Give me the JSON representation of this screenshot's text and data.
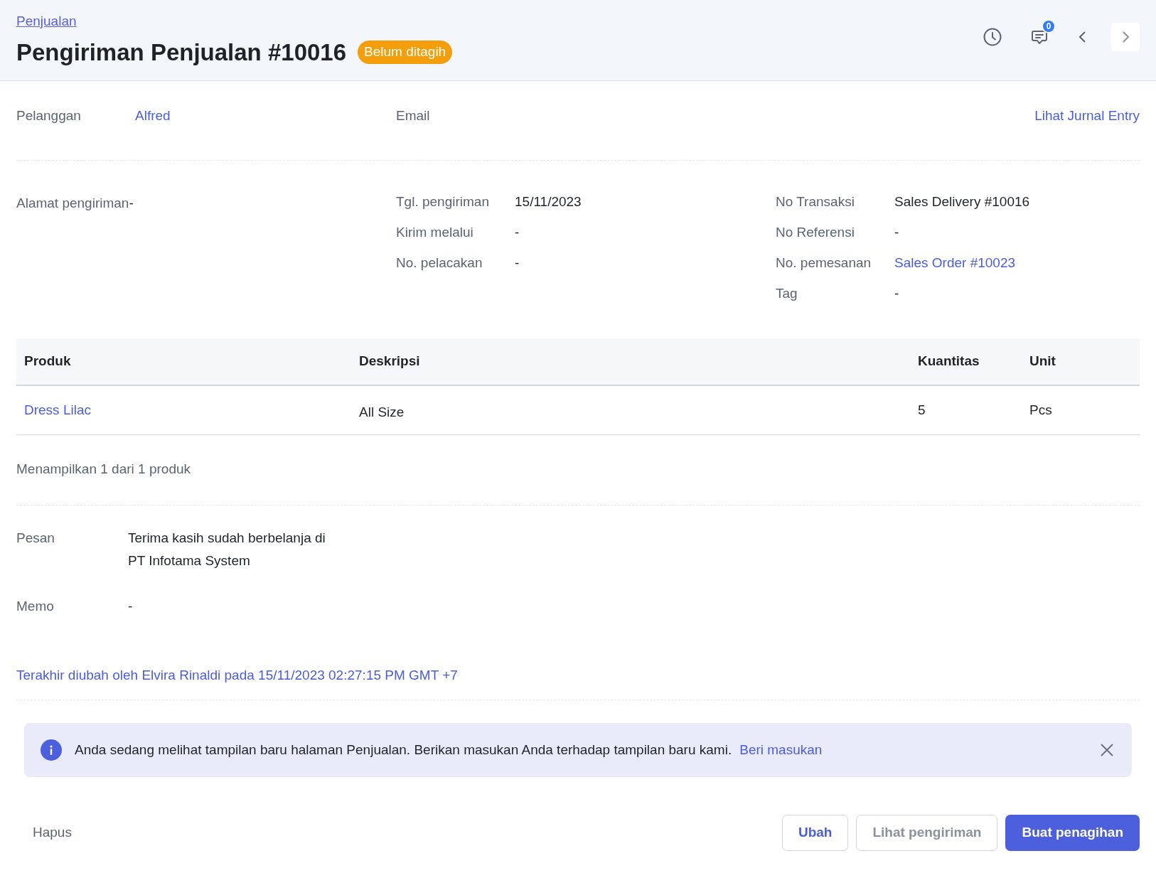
{
  "header": {
    "breadcrumb": "Penjualan",
    "title": "Pengiriman Penjualan #10016",
    "status_badge": "Belum ditagih",
    "comment_count": "0"
  },
  "summary": {
    "customer_label": "Pelanggan",
    "customer": "Alfred",
    "email_label": "Email",
    "journal_link": "Lihat Jurnal Entry"
  },
  "details": {
    "address_label": "Alamat pengiriman",
    "address": "-",
    "middle": [
      {
        "label": "Tgl. pengiriman",
        "value": "15/11/2023"
      },
      {
        "label": "Kirim melalui",
        "value": "-"
      },
      {
        "label": "No. pelacakan",
        "value": "-"
      }
    ],
    "right": [
      {
        "label": "No Transaksi",
        "value": "Sales Delivery #10016",
        "kind": "text"
      },
      {
        "label": "No Referensi",
        "value": "-",
        "kind": "text"
      },
      {
        "label": "No. pemesanan",
        "value": "Sales Order #10023",
        "kind": "link"
      },
      {
        "label": "Tag",
        "value": "-",
        "kind": "text"
      }
    ]
  },
  "table": {
    "columns": [
      "Produk",
      "Deskripsi",
      "Kuantitas",
      "Unit"
    ],
    "rows": [
      [
        "Dress Lilac",
        "All Size",
        "5",
        "Pcs"
      ]
    ],
    "footer": "Menampilkan 1 dari 1 produk"
  },
  "notes": {
    "message_label": "Pesan",
    "message_lines": [
      "Terima kasih sudah berbelanja di",
      "PT Infotama System"
    ],
    "memo_label": "Memo",
    "memo": "-"
  },
  "last_modified": "Terakhir diubah oleh Elvira Rinaldi pada 15/11/2023 02:27:15 PM GMT +7",
  "banner": {
    "text": "Anda sedang melihat tampilan baru halaman Penjualan. Berikan masukan Anda terhadap tampilan baru kami.",
    "link": "Beri masukan"
  },
  "actions": {
    "delete": "Hapus",
    "buttons": [
      {
        "label": "Ubah",
        "kind": "outline",
        "disabled": false
      },
      {
        "label": "Lihat pengiriman",
        "kind": "outline",
        "disabled": true
      },
      {
        "label": "Buat penagihan",
        "kind": "primary",
        "disabled": false
      }
    ]
  }
}
